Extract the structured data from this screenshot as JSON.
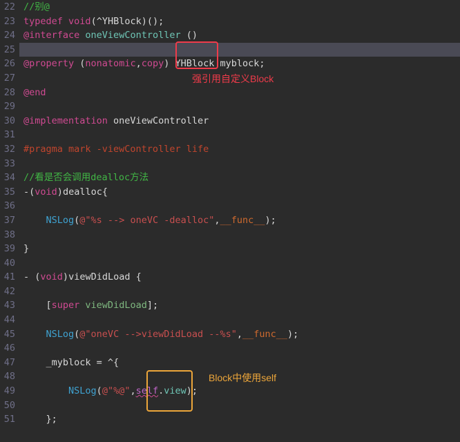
{
  "gutter": {
    "start": 22,
    "end": 51
  },
  "lines": {
    "l22_comment": "//别@",
    "l23_typedef": "typedef",
    "l23_void": "void",
    "l23_block": "(^YHBlock)();",
    "l24_at": "@interface",
    "l24_class": "oneViewController",
    "l24_tail": " ()",
    "l26_prop": "@property",
    "l26_p1": " (",
    "l26_nonatomic": "nonatomic",
    "l26_comma": ",",
    "l26_copy": "copy",
    "l26_p2": ") ",
    "l26_type": "YHBlock",
    "l26_name": " myblock;",
    "l28_end": "@end",
    "l30_impl": "@implementation",
    "l30_class": " oneViewController",
    "l32_pragma": "#pragma mark -viewController life",
    "l34_comment": "//看是否会调用dealloc方法",
    "l35_dash": "-",
    "l35_p1": "(",
    "l35_void": "void",
    "l35_p2": ")",
    "l35_dealloc": "dealloc{",
    "l37_nslog": "NSLog",
    "l37_p1": "(",
    "l37_str": "@\"%s --> oneVC -dealloc\"",
    "l37_comma": ",",
    "l37_func": "__func__",
    "l37_p2": ");",
    "l39_brace": "}",
    "l41_dash": "- ",
    "l41_p1": "(",
    "l41_void": "void",
    "l41_p2": ")",
    "l41_name": "viewDidLoad {",
    "l43_br1": "[",
    "l43_super": "super",
    "l43_vdl": " viewDidLoad",
    "l43_br2": "];",
    "l45_nslog": "NSLog",
    "l45_p1": "(",
    "l45_str": "@\"oneVC -->viewDidLoad --%s\"",
    "l45_comma": ",",
    "l45_func": "__func__",
    "l45_p2": ");",
    "l47_myblock": "_myblock",
    "l47_eq": " = ^{",
    "l49_nslog": "NSLog",
    "l49_p1": "(",
    "l49_str": "@\"%@\"",
    "l49_comma": ",",
    "l49_self": "self",
    "l49_dot": ".",
    "l49_view": "view",
    "l49_p2": ");",
    "l51_brace": "};"
  },
  "annotations": {
    "red_label": "强引用自定义Block",
    "yellow_label": "Block中使用self"
  },
  "chart_data": {
    "type": "table",
    "description": "Objective-C source code listing with annotation callouts",
    "language": "Objective-C",
    "line_numbers": [
      22,
      23,
      24,
      25,
      26,
      27,
      28,
      29,
      30,
      31,
      32,
      33,
      34,
      35,
      36,
      37,
      38,
      39,
      40,
      41,
      42,
      43,
      44,
      45,
      46,
      47,
      48,
      49,
      50,
      51
    ],
    "source_lines": [
      "//别@",
      "typedef void(^YHBlock)();",
      "@interface oneViewController ()",
      "",
      "@property (nonatomic,copy) YHBlock myblock;",
      "",
      "@end",
      "",
      "@implementation oneViewController",
      "",
      "#pragma mark -viewController life",
      "",
      "//看是否会调用dealloc方法",
      "-(void)dealloc{",
      "",
      "    NSLog(@\"%s --> oneVC -dealloc\",__func__);",
      "",
      "}",
      "",
      "- (void)viewDidLoad {",
      "",
      "    [super viewDidLoad];",
      "",
      "    NSLog(@\"oneVC -->viewDidLoad --%s\",__func__);",
      "",
      "    _myblock = ^{",
      "",
      "        NSLog(@\"%@\",self.view);",
      "",
      "    };"
    ],
    "callouts": [
      {
        "target_line": 26,
        "target_token": "copy",
        "box": "red",
        "label": "强引用自定义Block"
      },
      {
        "target_line": 49,
        "target_token": "self",
        "box": "yellow",
        "label": "Block中使用self"
      }
    ],
    "cursor_line": 25
  }
}
